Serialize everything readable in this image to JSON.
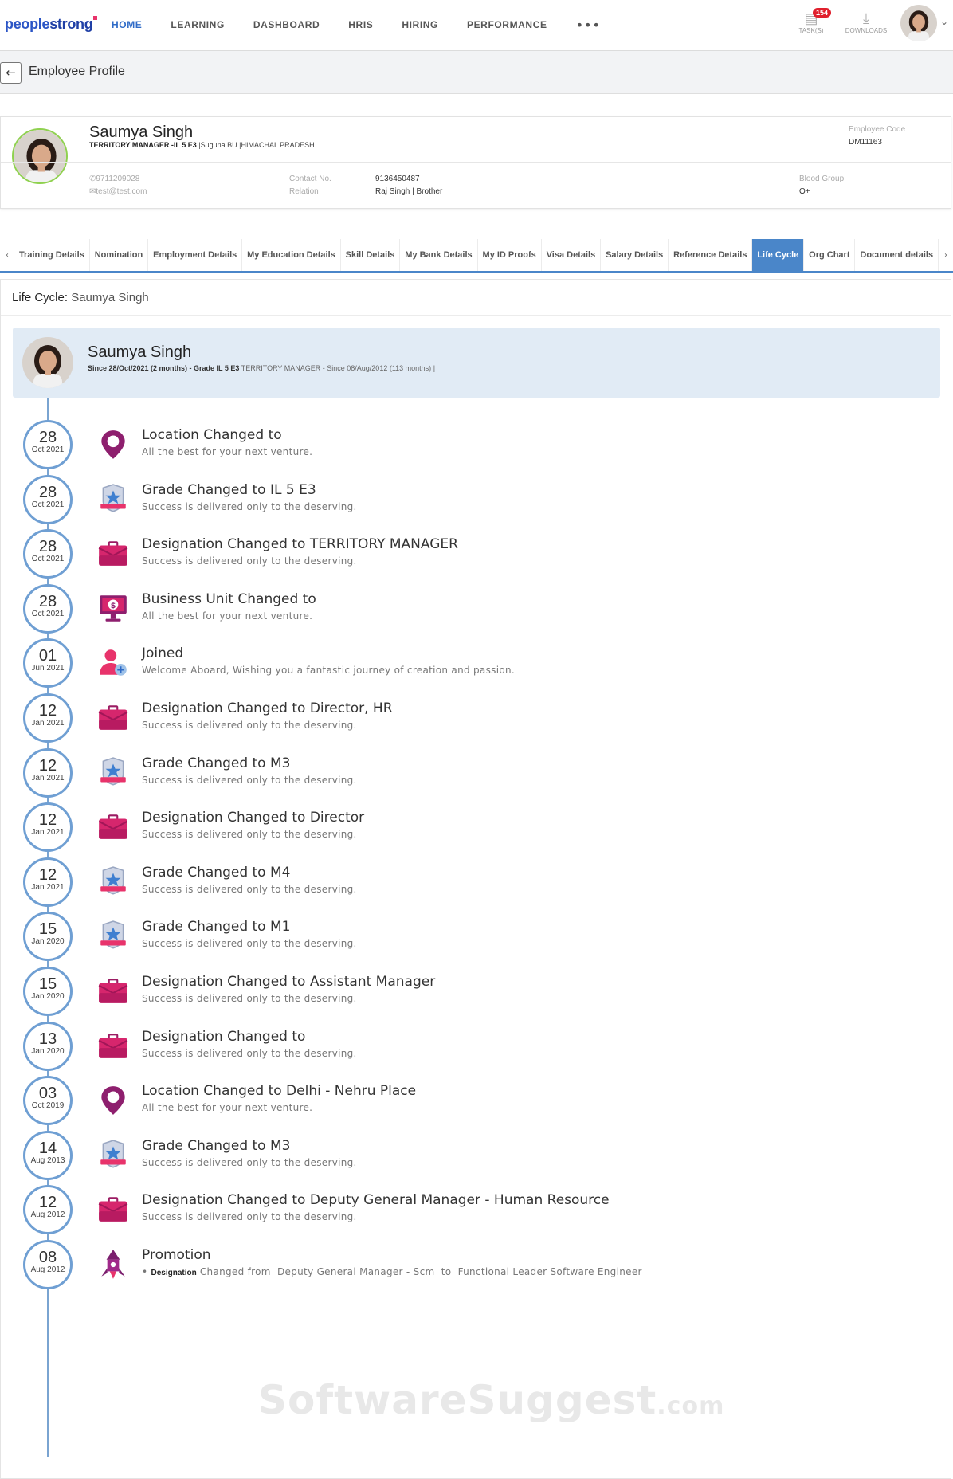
{
  "brand": {
    "logo_prefix": "people",
    "logo_suffix": "strong"
  },
  "nav": {
    "items": [
      "HOME",
      "LEARNING",
      "DASHBOARD",
      "HRIS",
      "HIRING",
      "PERFORMANCE"
    ],
    "more": "•••",
    "tasks_label": "TASK(S)",
    "tasks_count": "154",
    "downloads_label": "DOWNLOADS"
  },
  "page": {
    "title": "Employee Profile",
    "back_icon": "arrow-left-icon"
  },
  "profile": {
    "name": "Saumya Singh",
    "designation": "TERRITORY MANAGER",
    "grade": "-IL 5 E3",
    "bu": "|Suguna BU",
    "location": "|HIMACHAL PRADESH",
    "employee_code_label": "Employee Code",
    "employee_code": "DM11163",
    "phone": "9711209028",
    "email": "test@test.com",
    "contact_label": "Contact No.",
    "contact_value": "9136450487",
    "relation_label": "Relation",
    "relation_value": "Raj Singh | Brother",
    "blood_group_label": "Blood Group",
    "blood_group_value": "O+"
  },
  "tabs": {
    "prev": "‹",
    "next": "›",
    "items": [
      {
        "label": "Training Details",
        "active": false
      },
      {
        "label": "Nomination",
        "active": false
      },
      {
        "label": "Employment Details",
        "active": false
      },
      {
        "label": "My Education Details",
        "active": false
      },
      {
        "label": "Skill Details",
        "active": false
      },
      {
        "label": "My Bank Details",
        "active": false
      },
      {
        "label": "My ID Proofs",
        "active": false
      },
      {
        "label": "Visa Details",
        "active": false
      },
      {
        "label": "Salary Details",
        "active": false
      },
      {
        "label": "Reference Details",
        "active": false
      },
      {
        "label": "Life Cycle",
        "active": true
      },
      {
        "label": "Org Chart",
        "active": false
      },
      {
        "label": "Document details",
        "active": false
      }
    ]
  },
  "lifecycle": {
    "header_key": "Life Cycle:",
    "header_value": "Saumya Singh",
    "summary": {
      "name": "Saumya Singh",
      "since_grade": "Since 28/Oct/2021 (2 months) - Grade IL 5 E3",
      "role_since": "TERRITORY MANAGER - Since 08/Aug/2012 (113 months)",
      "sep": "|"
    },
    "events": [
      {
        "day": "28",
        "month_year": "Oct 2021",
        "icon": "location-pin-icon",
        "title": "Location Changed to",
        "desc": "All the best for your next venture."
      },
      {
        "day": "28",
        "month_year": "Oct 2021",
        "icon": "grade-badge-icon",
        "title": "Grade Changed to IL 5 E3",
        "desc": "Success is delivered only to the deserving."
      },
      {
        "day": "28",
        "month_year": "Oct 2021",
        "icon": "briefcase-icon",
        "title": "Designation Changed to TERRITORY MANAGER",
        "desc": "Success is delivered only to the deserving."
      },
      {
        "day": "28",
        "month_year": "Oct 2021",
        "icon": "business-unit-monitor-icon",
        "title": "Business Unit Changed to",
        "desc": "All the best for your next venture."
      },
      {
        "day": "01",
        "month_year": "Jun 2021",
        "icon": "user-add-icon",
        "title": "Joined",
        "desc": "Welcome Aboard, Wishing you a fantastic journey of creation and passion."
      },
      {
        "day": "12",
        "month_year": "Jan 2021",
        "icon": "briefcase-icon",
        "title": "Designation Changed to Director, HR",
        "desc": "Success is delivered only to the deserving."
      },
      {
        "day": "12",
        "month_year": "Jan 2021",
        "icon": "grade-badge-icon",
        "title": "Grade Changed to M3",
        "desc": "Success is delivered only to the deserving."
      },
      {
        "day": "12",
        "month_year": "Jan 2021",
        "icon": "briefcase-icon",
        "title": "Designation Changed to Director",
        "desc": "Success is delivered only to the deserving."
      },
      {
        "day": "12",
        "month_year": "Jan 2021",
        "icon": "grade-badge-icon",
        "title": "Grade Changed to M4",
        "desc": "Success is delivered only to the deserving."
      },
      {
        "day": "15",
        "month_year": "Jan 2020",
        "icon": "grade-badge-icon",
        "title": "Grade Changed to M1",
        "desc": "Success is delivered only to the deserving."
      },
      {
        "day": "15",
        "month_year": "Jan 2020",
        "icon": "briefcase-icon",
        "title": "Designation Changed to Assistant Manager",
        "desc": "Success is delivered only to the deserving."
      },
      {
        "day": "13",
        "month_year": "Jan 2020",
        "icon": "briefcase-icon",
        "title": "Designation Changed to",
        "desc": "Success is delivered only to the deserving."
      },
      {
        "day": "03",
        "month_year": "Oct 2019",
        "icon": "location-pin-icon",
        "title": "Location Changed to Delhi - Nehru Place",
        "desc": "All the best for your next venture."
      },
      {
        "day": "14",
        "month_year": "Aug 2013",
        "icon": "grade-badge-icon",
        "title": "Grade Changed to M3",
        "desc": "Success is delivered only to the deserving."
      },
      {
        "day": "12",
        "month_year": "Aug 2012",
        "icon": "briefcase-icon",
        "title": "Designation Changed to Deputy General Manager - Human Resource",
        "desc": "Success is delivered only to the deserving."
      }
    ],
    "promotion": {
      "day": "08",
      "month_year": "Aug 2012",
      "icon": "promotion-rocket-icon",
      "title": "Promotion",
      "bullet": "•",
      "field": "Designation",
      "changed_from": "Changed from",
      "from_value": "Deputy General Manager - Scm",
      "to": "to",
      "to_value": "Functional Leader Software Engineer"
    }
  },
  "watermark": {
    "main": "SoftwareSuggest",
    "suffix": ".com"
  },
  "colors": {
    "accent": "#4a86c9",
    "pink": "#c2185b",
    "purple": "#7b1f6e",
    "timeline": "#6f9fd3"
  }
}
